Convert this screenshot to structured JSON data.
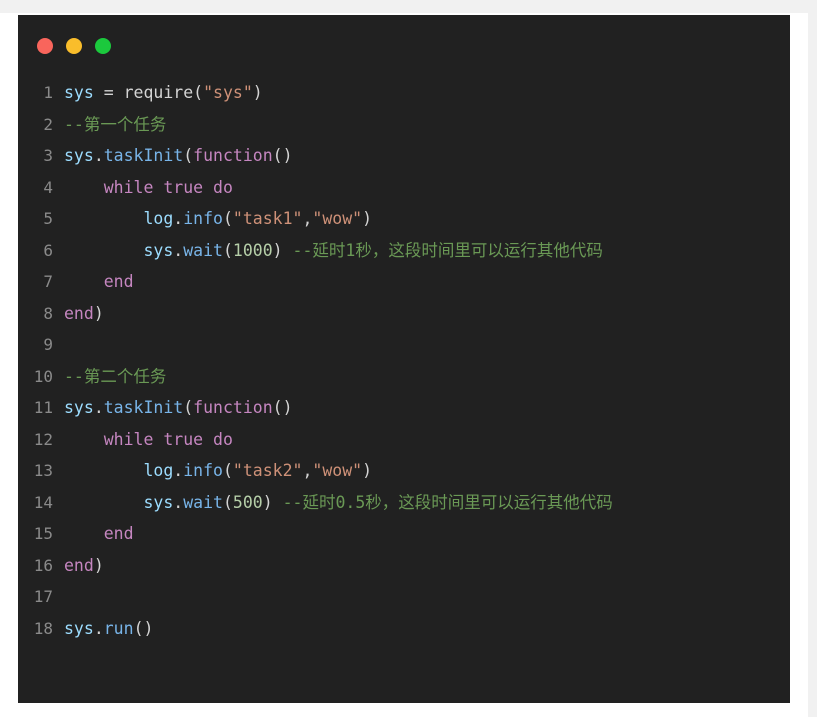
{
  "window": {
    "title_bar": {
      "buttons": [
        {
          "name": "close-button",
          "color": "#f9655c",
          "label": "close"
        },
        {
          "name": "minimize-button",
          "color": "#f9bd2b",
          "label": "minimize"
        },
        {
          "name": "maximize-button",
          "color": "#1bc93d",
          "label": "maximize"
        }
      ]
    },
    "background_color": "#212121",
    "card_color": "#ffffff",
    "page_color": "#f1f1f1"
  },
  "editor": {
    "language": "lua",
    "gutter_color": "#8a8a8a",
    "line_count": 18,
    "lines": [
      {
        "number": "1",
        "text": "sys = require(\"sys\")",
        "tokens": [
          {
            "t": "sys",
            "c": "t-var"
          },
          {
            "t": " = ",
            "c": "t-plain"
          },
          {
            "t": "require",
            "c": "t-plain"
          },
          {
            "t": "(",
            "c": "t-punct"
          },
          {
            "t": "\"sys\"",
            "c": "t-string"
          },
          {
            "t": ")",
            "c": "t-punct"
          }
        ]
      },
      {
        "number": "2",
        "text": "--第一个任务",
        "tokens": [
          {
            "t": "--第一个任务",
            "c": "t-comment"
          }
        ]
      },
      {
        "number": "3",
        "text": "sys.taskInit(function()",
        "tokens": [
          {
            "t": "sys",
            "c": "t-var"
          },
          {
            "t": ".",
            "c": "t-punct"
          },
          {
            "t": "taskInit",
            "c": "t-func"
          },
          {
            "t": "(",
            "c": "t-punct"
          },
          {
            "t": "function",
            "c": "t-keyword"
          },
          {
            "t": "()",
            "c": "t-punct"
          }
        ]
      },
      {
        "number": "4",
        "text": "    while true do",
        "tokens": [
          {
            "t": "    ",
            "c": "t-plain"
          },
          {
            "t": "while",
            "c": "t-keyword"
          },
          {
            "t": " ",
            "c": "t-plain"
          },
          {
            "t": "true",
            "c": "t-keyword"
          },
          {
            "t": " ",
            "c": "t-plain"
          },
          {
            "t": "do",
            "c": "t-keyword"
          }
        ]
      },
      {
        "number": "5",
        "text": "        log.info(\"task1\",\"wow\")",
        "tokens": [
          {
            "t": "        ",
            "c": "t-plain"
          },
          {
            "t": "log",
            "c": "t-var"
          },
          {
            "t": ".",
            "c": "t-punct"
          },
          {
            "t": "info",
            "c": "t-func"
          },
          {
            "t": "(",
            "c": "t-punct"
          },
          {
            "t": "\"task1\"",
            "c": "t-string"
          },
          {
            "t": ",",
            "c": "t-punct"
          },
          {
            "t": "\"wow\"",
            "c": "t-string"
          },
          {
            "t": ")",
            "c": "t-punct"
          }
        ]
      },
      {
        "number": "6",
        "text": "        sys.wait(1000) --延时1秒，这段时间里可以运行其他代码",
        "tokens": [
          {
            "t": "        ",
            "c": "t-plain"
          },
          {
            "t": "sys",
            "c": "t-var"
          },
          {
            "t": ".",
            "c": "t-punct"
          },
          {
            "t": "wait",
            "c": "t-func"
          },
          {
            "t": "(",
            "c": "t-punct"
          },
          {
            "t": "1000",
            "c": "t-number"
          },
          {
            "t": ")",
            "c": "t-punct"
          },
          {
            "t": " ",
            "c": "t-plain"
          },
          {
            "t": "--延时1秒，这段时间里可以运行其他代码",
            "c": "t-comment"
          }
        ]
      },
      {
        "number": "7",
        "text": "    end",
        "tokens": [
          {
            "t": "    ",
            "c": "t-plain"
          },
          {
            "t": "end",
            "c": "t-keyword"
          }
        ]
      },
      {
        "number": "8",
        "text": "end)",
        "tokens": [
          {
            "t": "end",
            "c": "t-keyword"
          },
          {
            "t": ")",
            "c": "t-punct"
          }
        ]
      },
      {
        "number": "9",
        "text": "",
        "tokens": []
      },
      {
        "number": "10",
        "text": "--第二个任务",
        "tokens": [
          {
            "t": "--第二个任务",
            "c": "t-comment"
          }
        ]
      },
      {
        "number": "11",
        "text": "sys.taskInit(function()",
        "tokens": [
          {
            "t": "sys",
            "c": "t-var"
          },
          {
            "t": ".",
            "c": "t-punct"
          },
          {
            "t": "taskInit",
            "c": "t-func"
          },
          {
            "t": "(",
            "c": "t-punct"
          },
          {
            "t": "function",
            "c": "t-keyword"
          },
          {
            "t": "()",
            "c": "t-punct"
          }
        ]
      },
      {
        "number": "12",
        "text": "    while true do",
        "tokens": [
          {
            "t": "    ",
            "c": "t-plain"
          },
          {
            "t": "while",
            "c": "t-keyword"
          },
          {
            "t": " ",
            "c": "t-plain"
          },
          {
            "t": "true",
            "c": "t-keyword"
          },
          {
            "t": " ",
            "c": "t-plain"
          },
          {
            "t": "do",
            "c": "t-keyword"
          }
        ]
      },
      {
        "number": "13",
        "text": "        log.info(\"task2\",\"wow\")",
        "tokens": [
          {
            "t": "        ",
            "c": "t-plain"
          },
          {
            "t": "log",
            "c": "t-var"
          },
          {
            "t": ".",
            "c": "t-punct"
          },
          {
            "t": "info",
            "c": "t-func"
          },
          {
            "t": "(",
            "c": "t-punct"
          },
          {
            "t": "\"task2\"",
            "c": "t-string"
          },
          {
            "t": ",",
            "c": "t-punct"
          },
          {
            "t": "\"wow\"",
            "c": "t-string"
          },
          {
            "t": ")",
            "c": "t-punct"
          }
        ]
      },
      {
        "number": "14",
        "text": "        sys.wait(500) --延时0.5秒，这段时间里可以运行其他代码",
        "tokens": [
          {
            "t": "        ",
            "c": "t-plain"
          },
          {
            "t": "sys",
            "c": "t-var"
          },
          {
            "t": ".",
            "c": "t-punct"
          },
          {
            "t": "wait",
            "c": "t-func"
          },
          {
            "t": "(",
            "c": "t-punct"
          },
          {
            "t": "500",
            "c": "t-number"
          },
          {
            "t": ")",
            "c": "t-punct"
          },
          {
            "t": " ",
            "c": "t-plain"
          },
          {
            "t": "--延时0.5秒，这段时间里可以运行其他代码",
            "c": "t-comment"
          }
        ]
      },
      {
        "number": "15",
        "text": "    end",
        "tokens": [
          {
            "t": "    ",
            "c": "t-plain"
          },
          {
            "t": "end",
            "c": "t-keyword"
          }
        ]
      },
      {
        "number": "16",
        "text": "end)",
        "tokens": [
          {
            "t": "end",
            "c": "t-keyword"
          },
          {
            "t": ")",
            "c": "t-punct"
          }
        ]
      },
      {
        "number": "17",
        "text": "",
        "tokens": []
      },
      {
        "number": "18",
        "text": "sys.run()",
        "tokens": [
          {
            "t": "sys",
            "c": "t-var"
          },
          {
            "t": ".",
            "c": "t-punct"
          },
          {
            "t": "run",
            "c": "t-func"
          },
          {
            "t": "()",
            "c": "t-punct"
          }
        ]
      }
    ]
  }
}
